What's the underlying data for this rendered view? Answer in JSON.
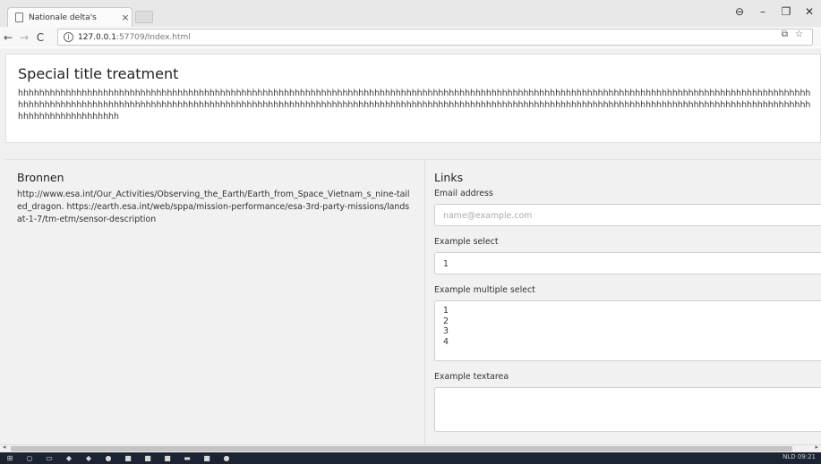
{
  "browser": {
    "tab_title": "Nationale delta's",
    "tab_close": "×",
    "url_host": "127.0.0.1",
    "url_rest": ":57709/Index.html",
    "nav": {
      "back": "←",
      "forward": "→",
      "reload": "C"
    },
    "window_controls": {
      "account": "⊖",
      "minimize": "–",
      "restore": "❐",
      "close": "✕"
    },
    "omni_right": {
      "translate": "⧉",
      "star": "☆"
    }
  },
  "card": {
    "title": "Special title treatment",
    "text": "hhhhhhhhhhhhhhhhhhhhhhhhhhhhhhhhhhhhhhhhhhhhhhhhhhhhhhhhhhhhhhhhhhhhhhhhhhhhhhhhhhhhhhhhhhhhhhhhhhhhhhhhhhhhhhhhhhhhhhhhhhhhhhhhhhhhhhhhhhhhhhhhhhhhhhhhhhhhhhhhhhhhhhhhhhhhhhhhhhhhhhhhhhhhhhhhhhhhhhhhhhhhhhhhhhhhhhhhhhhhhhhhhhhhhhhhhhhhhhhhhhhhhhhhhhhhhhhhhhhhhhhhhhhhhhhhhhhhhhhhhhhhhhhhhhhhhhhhhhhhhhhhhhhhhhhhhhhhh"
  },
  "bronnen": {
    "title": "Bronnen",
    "text": "http://www.esa.int/Our_Activities/Observing_the_Earth/Earth_from_Space_Vietnam_s_nine-tailed_dragon. https://earth.esa.int/web/sppa/mission-performance/esa-3rd-party-missions/landsat-1-7/tm-etm/sensor-description"
  },
  "links": {
    "title": "Links",
    "email_label": "Email address",
    "email_placeholder": "name@example.com",
    "select_label": "Example select",
    "select_value": "1",
    "multi_label": "Example multiple select",
    "multi_options": [
      "1",
      "2",
      "3",
      "4"
    ],
    "textarea_label": "Example textarea"
  },
  "taskbar": {
    "tray_text": "NLD  09:21"
  }
}
